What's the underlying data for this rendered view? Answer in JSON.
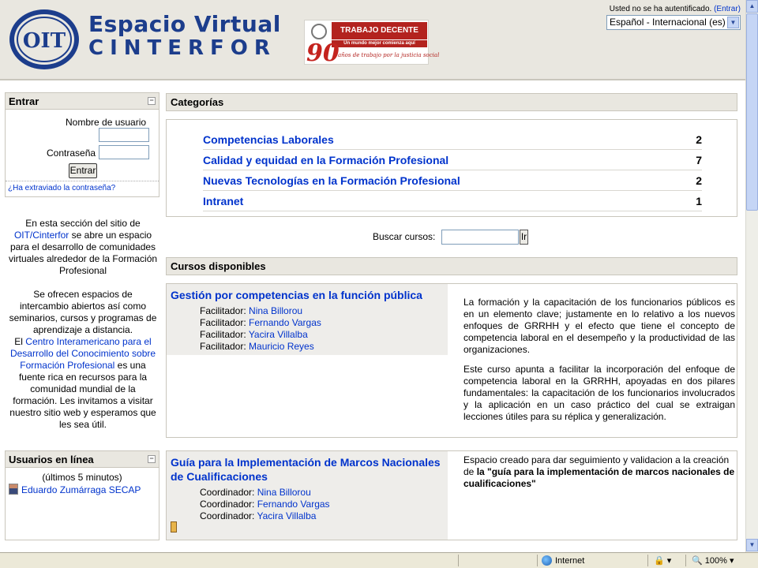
{
  "header": {
    "title_line1": "Espacio Virtual",
    "title_line2": "CINTERFOR",
    "logo_text": "OIT",
    "banner_title": "TRABAJO DECENTE",
    "banner_subtitle": "Un mundo mejor comienza aquí",
    "banner_number": "90",
    "banner_tagline": "años de trabajo por la justicia social",
    "login_status": "Usted no se ha autentificado.",
    "login_link": "(Entrar)",
    "language": "Español - Internacional (es)"
  },
  "login_block": {
    "title": "Entrar",
    "username_label": "Nombre de usuario",
    "password_label": "Contraseña",
    "button_label": "Entrar",
    "forgot_link": "¿Ha extraviado la contraseña?"
  },
  "description": {
    "p1_before": "En esta sección del sitio de ",
    "p1_link": "OIT/Cinterfor",
    "p1_after": " se abre un espacio para el desarrollo de comunidades virtuales alrededor de la Formación Profesional",
    "p2_line1": "Se ofrecen espacios de intercambio abiertos así como seminarios, cursos y programas de aprendizaje a distancia.",
    "p2_before": "El ",
    "p2_link": "Centro Interamericano para el Desarrollo del Conocimiento sobre Formación Profesional",
    "p2_after": " es una fuente rica en recursos para la comunidad mundial de la formación. Les invitamos a visitar nuestro sitio web y esperamos que les sea útil."
  },
  "online_users": {
    "title": "Usuarios en línea",
    "subtitle": "(últimos 5 minutos)",
    "users": [
      "Eduardo Zumárraga SECAP"
    ]
  },
  "categories": {
    "title": "Categorías",
    "items": [
      {
        "name": "Competencias Laborales",
        "count": "2"
      },
      {
        "name": "Calidad y equidad en la Formación Profesional",
        "count": "7"
      },
      {
        "name": "Nuevas Tecnologías en la Formación Profesional",
        "count": "2"
      },
      {
        "name": "Intranet",
        "count": "1"
      }
    ]
  },
  "search": {
    "label": "Buscar cursos:",
    "value": "",
    "button": "Ir"
  },
  "courses": {
    "title": "Cursos disponibles",
    "items": [
      {
        "title": "Gestión por competencias en la función pública",
        "role": "Facilitador:",
        "staff": [
          "Nina Billorou",
          "Fernando Vargas",
          "Yacira Villalba",
          "Mauricio Reyes"
        ],
        "summary_p1": "La formación y la capacitación de los funcionarios públicos es en un elemento clave; justamente en lo relativo a los nuevos enfoques de GRRHH y el efecto que tiene el concepto de competencia laboral en el desempeño y la productividad de las organizaciones.",
        "summary_p2": "Este curso apunta a facilitar la incorporación del enfoque de competencia laboral en la GRRHH, apoyadas en dos pilares fundamentales: la capacitación de los funcionarios involucrados y la aplicación en un caso práctico del cual se extraigan lecciones útiles para su réplica y generalización."
      },
      {
        "title": "Guía para la Implementación de Marcos Nacionales de Cualificaciones",
        "role": "Coordinador:",
        "staff": [
          "Nina Billorou",
          "Fernando Vargas",
          "Yacira Villalba"
        ],
        "summary_plain": "Espacio creado para dar seguimiento y validacion a la creación de ",
        "summary_bold": "la \"guía para la implementación de marcos nacionales de cualificaciones\""
      }
    ]
  },
  "statusbar": {
    "zone": "Internet",
    "zoom": "100%"
  },
  "colors": {
    "link": "#0033cc",
    "title_blue": "#1c3d8c",
    "header_bg": "#e9e7e0",
    "banner_red": "#b3231f"
  }
}
